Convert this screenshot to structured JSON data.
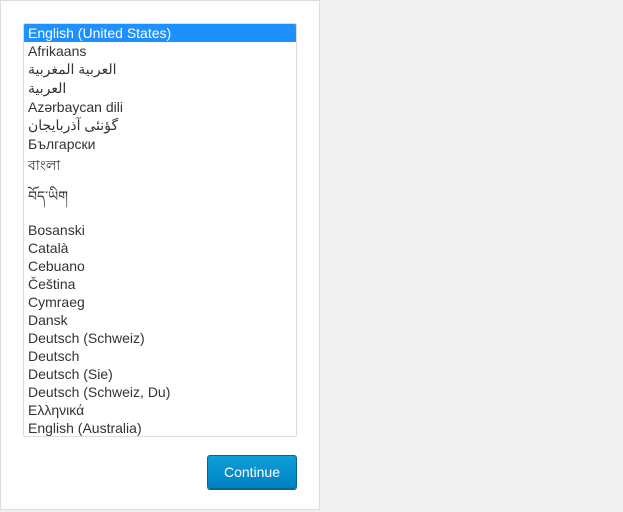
{
  "language_select": {
    "selected_index": 0,
    "options": [
      "English (United States)",
      "Afrikaans",
      "العربية المغربية",
      "العربية",
      "Azərbaycan dili",
      "گؤنئی آذربایجان",
      "Български",
      "বাংলা",
      "བོད་ཡིག",
      "Bosanski",
      "Català",
      "Cebuano",
      "Čeština",
      "Cymraeg",
      "Dansk",
      "Deutsch (Schweiz)",
      "Deutsch",
      "Deutsch (Sie)",
      "Deutsch (Schweiz, Du)",
      "Ελληνικά",
      "English (Australia)"
    ]
  },
  "buttons": {
    "continue_label": "Continue"
  }
}
